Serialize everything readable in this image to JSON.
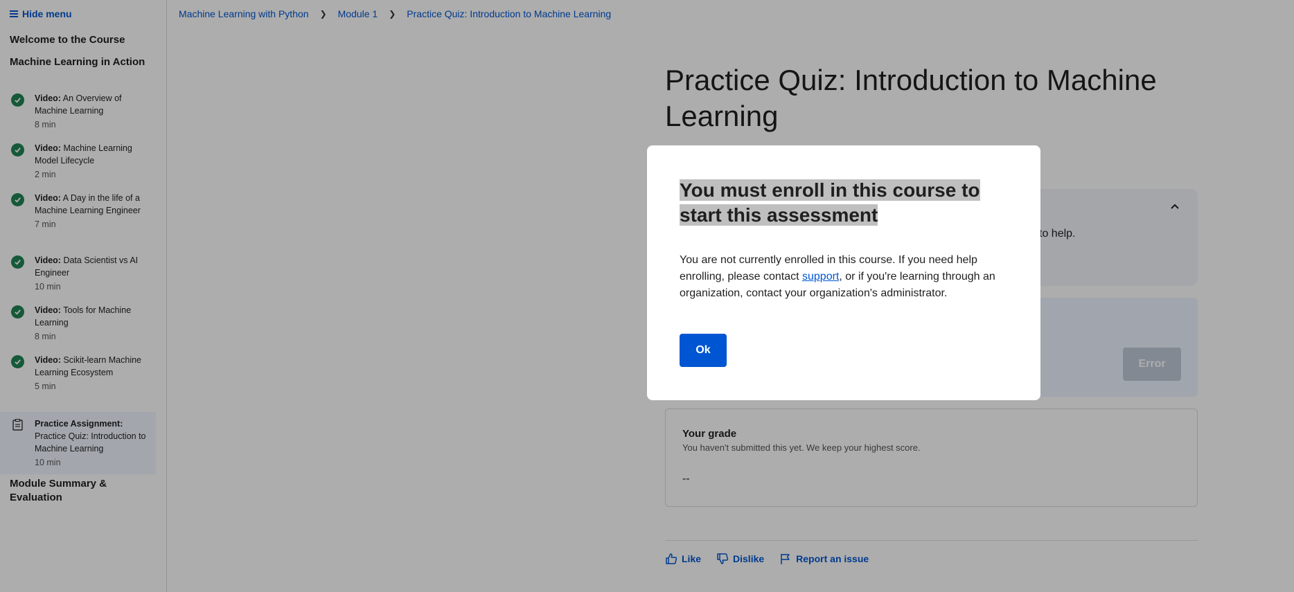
{
  "sidebar": {
    "hide_menu": "Hide menu",
    "sections": [
      "Welcome to the Course",
      "Machine Learning in Action",
      "Module Summary & Evaluation"
    ],
    "lessons": [
      {
        "type": "Video:",
        "title": " An Overview of Machine Learning",
        "duration": "8 min",
        "completed": true
      },
      {
        "type": "Video:",
        "title": " Machine Learning Model Lifecycle",
        "duration": "2 min",
        "completed": true
      },
      {
        "type": "Video:",
        "title": " A Day in the life of a Machine Learning Engineer",
        "duration": "7 min",
        "completed": true
      },
      {
        "type": "Video:",
        "title": " Data Scientist vs AI Engineer",
        "duration": "10 min",
        "completed": true
      },
      {
        "type": "Video:",
        "title": " Tools for Machine Learning",
        "duration": "8 min",
        "completed": true
      },
      {
        "type": "Video:",
        "title": " Scikit-learn Machine Learning Ecosystem",
        "duration": "5 min",
        "completed": true
      },
      {
        "type": "Practice Assignment:",
        "title": " Practice Quiz: Introduction to Machine Learning",
        "duration": "10 min",
        "completed": false
      }
    ]
  },
  "breadcrumb": [
    "Machine Learning with Python",
    "Module 1",
    "Practice Quiz: Introduction to Machine Learning"
  ],
  "page_title": "Practice Quiz: Introduction to Machine Learning",
  "card_fragment": "to help.",
  "error_button": "Error",
  "grade": {
    "title": "Your grade",
    "subtitle": "You haven't submitted this yet. We keep your highest score.",
    "score": "--"
  },
  "actions": {
    "like": "Like",
    "dislike": "Dislike",
    "report": "Report an issue"
  },
  "modal": {
    "title": "You must enroll in this course to start this assessment",
    "body_before": "You are not currently enrolled in this course. If you need help enrolling, please contact ",
    "body_link": "support",
    "body_after": ", or if you're learning through an organization, contact your organization's administrator.",
    "ok": "Ok"
  },
  "colors": {
    "accent": "#0056d2",
    "completed": "#1f8354",
    "overlay": "rgba(0,0,0,0.32)"
  }
}
